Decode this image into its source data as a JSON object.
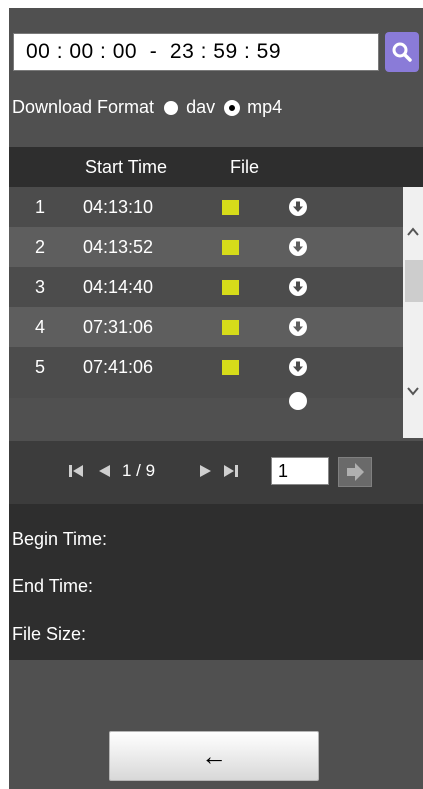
{
  "search": {
    "time_range": "00 : 00 : 00  -  23 : 59 : 59",
    "button_icon": "search-icon"
  },
  "download_format": {
    "label": "Download Format",
    "options": [
      {
        "label": "dav",
        "selected": false
      },
      {
        "label": "mp4",
        "selected": true
      }
    ]
  },
  "table": {
    "headers": {
      "start_time": "Start Time",
      "file": "File"
    },
    "rows": [
      {
        "num": "1",
        "start_time": "04:13:10"
      },
      {
        "num": "2",
        "start_time": "04:13:52"
      },
      {
        "num": "3",
        "start_time": "04:14:40"
      },
      {
        "num": "4",
        "start_time": "07:31:06"
      },
      {
        "num": "5",
        "start_time": "07:41:06"
      }
    ],
    "file_color": "#d6dc1a"
  },
  "pager": {
    "label": "1 / 9",
    "page_input": "1",
    "icons": [
      "first-page-icon",
      "prev-page-icon",
      "next-page-icon",
      "last-page-icon",
      "go-icon"
    ]
  },
  "info": {
    "begin_time": "Begin Time:",
    "end_time": "End Time:",
    "file_size": "File Size:"
  },
  "back_button": {
    "icon": "arrow-left-icon",
    "label": "←"
  }
}
